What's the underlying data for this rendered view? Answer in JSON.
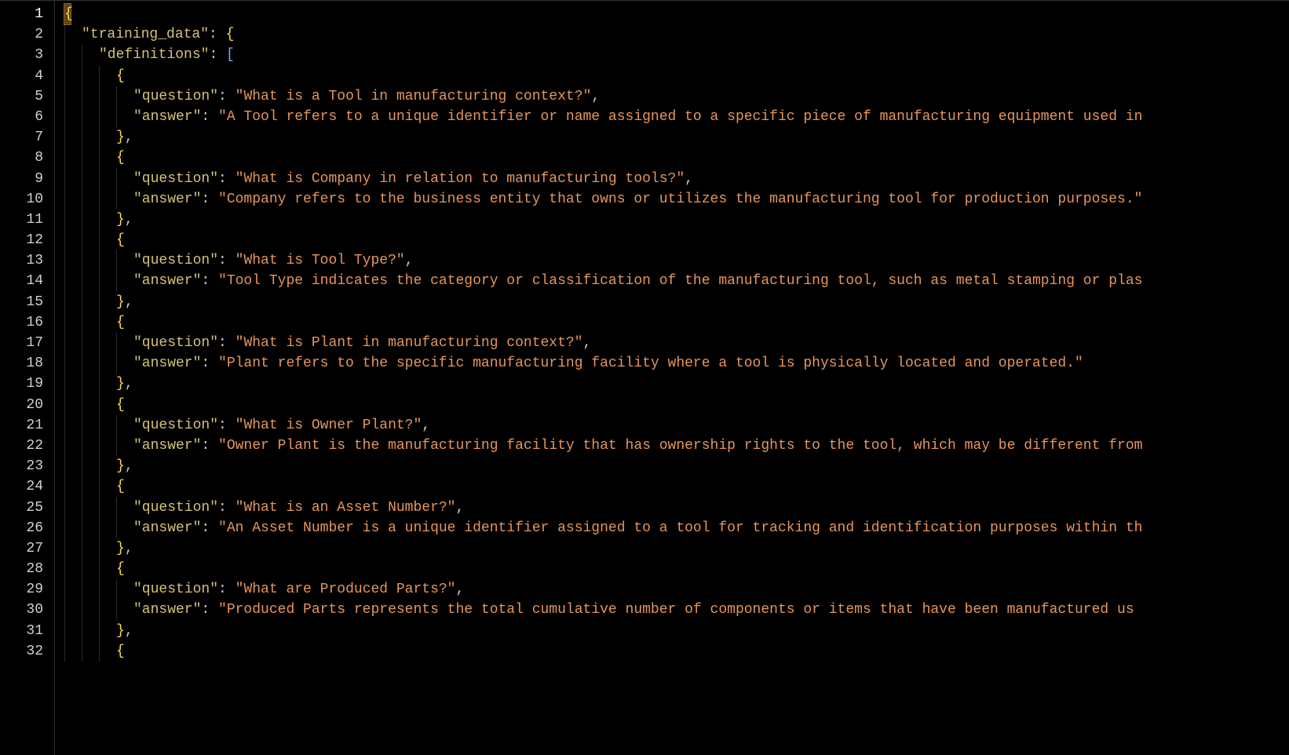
{
  "editor": {
    "lines": [
      {
        "num": 1,
        "indent": 0,
        "tokens": [
          {
            "t": "{",
            "c": "brace"
          }
        ]
      },
      {
        "num": 2,
        "indent": 1,
        "tokens": [
          {
            "t": "\"training_data\"",
            "c": "key"
          },
          {
            "t": ": ",
            "c": "punc"
          },
          {
            "t": "{",
            "c": "brace"
          }
        ]
      },
      {
        "num": 3,
        "indent": 2,
        "tokens": [
          {
            "t": "\"definitions\"",
            "c": "key"
          },
          {
            "t": ": ",
            "c": "punc"
          },
          {
            "t": "[",
            "c": "bracket"
          }
        ]
      },
      {
        "num": 4,
        "indent": 3,
        "tokens": [
          {
            "t": "{",
            "c": "brace"
          }
        ]
      },
      {
        "num": 5,
        "indent": 4,
        "tokens": [
          {
            "t": "\"question\"",
            "c": "key"
          },
          {
            "t": ": ",
            "c": "punc"
          },
          {
            "t": "\"What is a Tool in manufacturing context?\"",
            "c": "str"
          },
          {
            "t": ",",
            "c": "punc"
          }
        ]
      },
      {
        "num": 6,
        "indent": 4,
        "tokens": [
          {
            "t": "\"answer\"",
            "c": "key"
          },
          {
            "t": ": ",
            "c": "punc"
          },
          {
            "t": "\"A Tool refers to a unique identifier or name assigned to a specific piece of manufacturing equipment used in",
            "c": "str"
          }
        ]
      },
      {
        "num": 7,
        "indent": 3,
        "tokens": [
          {
            "t": "}",
            "c": "brace"
          },
          {
            "t": ",",
            "c": "punc"
          }
        ]
      },
      {
        "num": 8,
        "indent": 3,
        "tokens": [
          {
            "t": "{",
            "c": "brace"
          }
        ]
      },
      {
        "num": 9,
        "indent": 4,
        "tokens": [
          {
            "t": "\"question\"",
            "c": "key"
          },
          {
            "t": ": ",
            "c": "punc"
          },
          {
            "t": "\"What is Company in relation to manufacturing tools?\"",
            "c": "str"
          },
          {
            "t": ",",
            "c": "punc"
          }
        ]
      },
      {
        "num": 10,
        "indent": 4,
        "tokens": [
          {
            "t": "\"answer\"",
            "c": "key"
          },
          {
            "t": ": ",
            "c": "punc"
          },
          {
            "t": "\"Company refers to the business entity that owns or utilizes the manufacturing tool for production purposes.\"",
            "c": "str"
          }
        ]
      },
      {
        "num": 11,
        "indent": 3,
        "tokens": [
          {
            "t": "}",
            "c": "brace"
          },
          {
            "t": ",",
            "c": "punc"
          }
        ]
      },
      {
        "num": 12,
        "indent": 3,
        "tokens": [
          {
            "t": "{",
            "c": "brace"
          }
        ]
      },
      {
        "num": 13,
        "indent": 4,
        "tokens": [
          {
            "t": "\"question\"",
            "c": "key"
          },
          {
            "t": ": ",
            "c": "punc"
          },
          {
            "t": "\"What is Tool Type?\"",
            "c": "str"
          },
          {
            "t": ",",
            "c": "punc"
          }
        ]
      },
      {
        "num": 14,
        "indent": 4,
        "tokens": [
          {
            "t": "\"answer\"",
            "c": "key"
          },
          {
            "t": ": ",
            "c": "punc"
          },
          {
            "t": "\"Tool Type indicates the category or classification of the manufacturing tool, such as metal stamping or plas",
            "c": "str"
          }
        ]
      },
      {
        "num": 15,
        "indent": 3,
        "tokens": [
          {
            "t": "}",
            "c": "brace"
          },
          {
            "t": ",",
            "c": "punc"
          }
        ]
      },
      {
        "num": 16,
        "indent": 3,
        "tokens": [
          {
            "t": "{",
            "c": "brace"
          }
        ]
      },
      {
        "num": 17,
        "indent": 4,
        "tokens": [
          {
            "t": "\"question\"",
            "c": "key"
          },
          {
            "t": ": ",
            "c": "punc"
          },
          {
            "t": "\"What is Plant in manufacturing context?\"",
            "c": "str"
          },
          {
            "t": ",",
            "c": "punc"
          }
        ]
      },
      {
        "num": 18,
        "indent": 4,
        "tokens": [
          {
            "t": "\"answer\"",
            "c": "key"
          },
          {
            "t": ": ",
            "c": "punc"
          },
          {
            "t": "\"Plant refers to the specific manufacturing facility where a tool is physically located and operated.\"",
            "c": "str"
          }
        ]
      },
      {
        "num": 19,
        "indent": 3,
        "tokens": [
          {
            "t": "}",
            "c": "brace"
          },
          {
            "t": ",",
            "c": "punc"
          }
        ]
      },
      {
        "num": 20,
        "indent": 3,
        "tokens": [
          {
            "t": "{",
            "c": "brace"
          }
        ]
      },
      {
        "num": 21,
        "indent": 4,
        "tokens": [
          {
            "t": "\"question\"",
            "c": "key"
          },
          {
            "t": ": ",
            "c": "punc"
          },
          {
            "t": "\"What is Owner Plant?\"",
            "c": "str"
          },
          {
            "t": ",",
            "c": "punc"
          }
        ]
      },
      {
        "num": 22,
        "indent": 4,
        "tokens": [
          {
            "t": "\"answer\"",
            "c": "key"
          },
          {
            "t": ": ",
            "c": "punc"
          },
          {
            "t": "\"Owner Plant is the manufacturing facility that has ownership rights to the tool, which may be different from",
            "c": "str"
          }
        ]
      },
      {
        "num": 23,
        "indent": 3,
        "tokens": [
          {
            "t": "}",
            "c": "brace"
          },
          {
            "t": ",",
            "c": "punc"
          }
        ]
      },
      {
        "num": 24,
        "indent": 3,
        "tokens": [
          {
            "t": "{",
            "c": "brace"
          }
        ]
      },
      {
        "num": 25,
        "indent": 4,
        "tokens": [
          {
            "t": "\"question\"",
            "c": "key"
          },
          {
            "t": ": ",
            "c": "punc"
          },
          {
            "t": "\"What is an Asset Number?\"",
            "c": "str"
          },
          {
            "t": ",",
            "c": "punc"
          }
        ]
      },
      {
        "num": 26,
        "indent": 4,
        "tokens": [
          {
            "t": "\"answer\"",
            "c": "key"
          },
          {
            "t": ": ",
            "c": "punc"
          },
          {
            "t": "\"An Asset Number is a unique identifier assigned to a tool for tracking and identification purposes within th",
            "c": "str"
          }
        ]
      },
      {
        "num": 27,
        "indent": 3,
        "tokens": [
          {
            "t": "}",
            "c": "brace"
          },
          {
            "t": ",",
            "c": "punc"
          }
        ]
      },
      {
        "num": 28,
        "indent": 3,
        "tokens": [
          {
            "t": "{",
            "c": "brace"
          }
        ]
      },
      {
        "num": 29,
        "indent": 4,
        "tokens": [
          {
            "t": "\"question\"",
            "c": "key"
          },
          {
            "t": ": ",
            "c": "punc"
          },
          {
            "t": "\"What are Produced Parts?\"",
            "c": "str"
          },
          {
            "t": ",",
            "c": "punc"
          }
        ]
      },
      {
        "num": 30,
        "indent": 4,
        "tokens": [
          {
            "t": "\"answer\"",
            "c": "key"
          },
          {
            "t": ": ",
            "c": "punc"
          },
          {
            "t": "\"Produced Parts represents the total cumulative number of components or items that have been manufactured us",
            "c": "str"
          }
        ]
      },
      {
        "num": 31,
        "indent": 3,
        "tokens": [
          {
            "t": "}",
            "c": "brace"
          },
          {
            "t": ",",
            "c": "punc"
          }
        ]
      },
      {
        "num": 32,
        "indent": 3,
        "tokens": [
          {
            "t": "{",
            "c": "brace"
          }
        ]
      }
    ]
  }
}
